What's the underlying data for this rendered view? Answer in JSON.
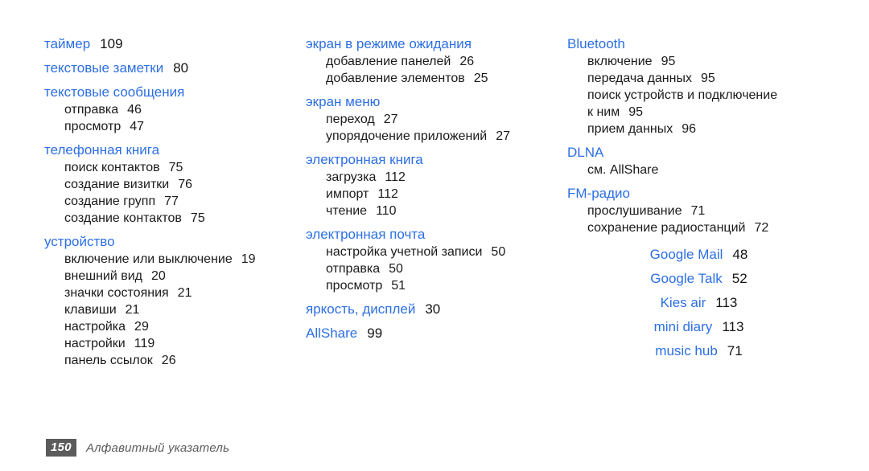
{
  "page": {
    "background_color": "#ffffff",
    "heading_color": "#2c6fe4",
    "text_color": "#1a1a1a",
    "footer_color": "#5b5b5b"
  },
  "footer": {
    "page_number": "150",
    "label": "Алфавитный указатель"
  },
  "columns": [
    {
      "id": "column-1",
      "groups": [
        {
          "heading": "таймер",
          "heading_page": "109",
          "items": []
        },
        {
          "heading": "текстовые заметки",
          "heading_page": "80",
          "items": []
        },
        {
          "heading": "текстовые сообщения",
          "heading_page": "",
          "items": [
            {
              "label": "отправка",
              "page": "46"
            },
            {
              "label": "просмотр",
              "page": "47"
            }
          ]
        },
        {
          "heading": "телефонная книга",
          "heading_page": "",
          "items": [
            {
              "label": "поиск контактов",
              "page": "75"
            },
            {
              "label": "создание визитки",
              "page": "76"
            },
            {
              "label": "создание групп",
              "page": "77"
            },
            {
              "label": "создание контактов",
              "page": "75"
            }
          ]
        },
        {
          "heading": "устройство",
          "heading_page": "",
          "items": [
            {
              "label": "включение или выключение",
              "page": "19"
            },
            {
              "label": "внешний вид",
              "page": "20"
            },
            {
              "label": "значки состояния",
              "page": "21"
            },
            {
              "label": "клавиши",
              "page": "21"
            },
            {
              "label": "настройка",
              "page": "29"
            },
            {
              "label": "настройки",
              "page": "119"
            },
            {
              "label": "панель ссылок",
              "page": "26"
            }
          ]
        }
      ]
    },
    {
      "id": "column-2",
      "groups": [
        {
          "heading": "экран в режиме ожидания",
          "heading_page": "",
          "items": [
            {
              "label": "добавление панелей",
              "page": "26"
            },
            {
              "label": "добавление элементов",
              "page": "25"
            }
          ]
        },
        {
          "heading": "экран меню",
          "heading_page": "",
          "items": [
            {
              "label": "переход",
              "page": "27"
            },
            {
              "label": "упорядочение приложений",
              "page": "27"
            }
          ]
        },
        {
          "heading": "электронная книга",
          "heading_page": "",
          "items": [
            {
              "label": "загрузка",
              "page": "112"
            },
            {
              "label": "импорт",
              "page": "112"
            },
            {
              "label": "чтение",
              "page": "110"
            }
          ]
        },
        {
          "heading": "электронная почта",
          "heading_page": "",
          "items": [
            {
              "label": "настройка учетной записи",
              "page": "50"
            },
            {
              "label": "отправка",
              "page": "50"
            },
            {
              "label": "просмотр",
              "page": "51"
            }
          ]
        },
        {
          "heading": "яркость, дисплей",
          "heading_page": "30",
          "items": []
        },
        {
          "heading": "AllShare",
          "heading_page": "99",
          "items": []
        }
      ]
    },
    {
      "id": "column-3",
      "groups": [
        {
          "heading": "Bluetooth",
          "heading_page": "",
          "items": [
            {
              "label": "включение",
              "page": "95"
            },
            {
              "label": "передача данных",
              "page": "95"
            },
            {
              "label": "поиск устройств и подключение",
              "page": ""
            },
            {
              "label": "к ним",
              "page": "95",
              "continuation": true
            },
            {
              "label": "прием данных",
              "page": "96"
            }
          ]
        },
        {
          "heading": "DLNA",
          "heading_page": "",
          "items": [
            {
              "label": "см. AllShare",
              "page": ""
            }
          ]
        },
        {
          "heading": "FM-радио",
          "heading_page": "",
          "items": [
            {
              "label": "прослушивание",
              "page": "71"
            },
            {
              "label": "сохранение радиостанций",
              "page": "72"
            }
          ]
        }
      ],
      "centered_entries": [
        {
          "heading": "Google Mail",
          "heading_page": "48"
        },
        {
          "heading": "Google Talk",
          "heading_page": "52"
        },
        {
          "heading": "Kies air",
          "heading_page": "113"
        },
        {
          "heading": "mini diary",
          "heading_page": "113"
        },
        {
          "heading": "music hub",
          "heading_page": "71"
        }
      ]
    }
  ]
}
